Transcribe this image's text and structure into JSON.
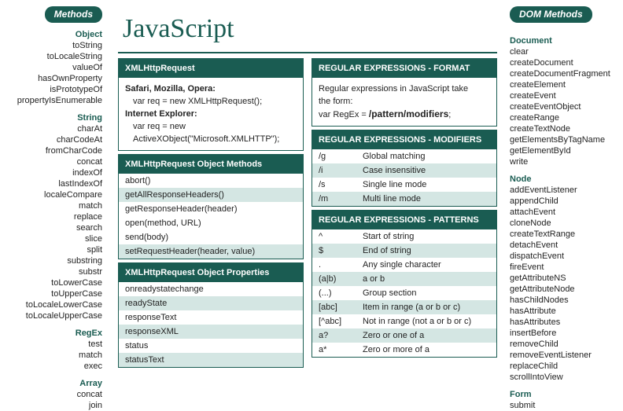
{
  "title": "JavaScript",
  "left_badge": "Methods",
  "right_badge": "DOM Methods",
  "left_groups": [
    {
      "title": "Object",
      "items": [
        "toString",
        "toLocaleString",
        "valueOf",
        "hasOwnProperty",
        "isPrototypeOf",
        "propertyIsEnumerable"
      ]
    },
    {
      "title": "String",
      "items": [
        "charAt",
        "charCodeAt",
        "fromCharCode",
        "concat",
        "indexOf",
        "lastIndexOf",
        "localeCompare",
        "match",
        "replace",
        "search",
        "slice",
        "split",
        "substring",
        "substr",
        "toLowerCase",
        "toUpperCase",
        "toLocaleLowerCase",
        "toLocaleUpperCase"
      ]
    },
    {
      "title": "RegEx",
      "items": [
        "test",
        "match",
        "exec"
      ]
    },
    {
      "title": "Array",
      "items": [
        "concat",
        "join"
      ]
    }
  ],
  "right_groups": [
    {
      "title": "Document",
      "items": [
        "clear",
        "createDocument",
        "createDocumentFragment",
        "createElement",
        "createEvent",
        "createEventObject",
        "createRange",
        "createTextNode",
        "getElementsByTagName",
        "getElementById",
        "write"
      ]
    },
    {
      "title": "Node",
      "items": [
        "addEventListener",
        "appendChild",
        "attachEvent",
        "cloneNode",
        "createTextRange",
        "detachEvent",
        "dispatchEvent",
        "fireEvent",
        "getAttributeNS",
        "getAttributeNode",
        "hasChildNodes",
        "hasAttribute",
        "hasAttributes",
        "insertBefore",
        "removeChild",
        "removeEventListener",
        "replaceChild",
        "scrollIntoView"
      ]
    },
    {
      "title": "Form",
      "items": [
        "submit"
      ]
    }
  ],
  "xhr": {
    "header": "XMLHttpRequest",
    "b1_label": "Safari, Mozilla, Opera:",
    "b1_code": "var req = new XMLHttpRequest();",
    "b2_label": "Internet Explorer:",
    "b2_code1": "var req = new",
    "b2_code2": "ActiveXObject(\"Microsoft.XMLHTTP\");"
  },
  "xhr_methods": {
    "header": "XMLHttpRequest Object Methods",
    "items": [
      "abort()",
      "getAllResponseHeaders()",
      "getResponseHeader(header)",
      "open(method, URL)",
      "send(body)",
      "setRequestHeader(header, value)"
    ]
  },
  "xhr_props": {
    "header": "XMLHttpRequest Object Properties",
    "items": [
      "onreadystatechange",
      "readyState",
      "responseText",
      "responseXML",
      "status",
      "statusText"
    ]
  },
  "regex_format": {
    "header": "REGULAR EXPRESSIONS - FORMAT",
    "line1": "Regular expressions in JavaScript take",
    "line2": "the form:",
    "line3_pre": "var RegEx = ",
    "line3_bold": "/pattern/modifiers",
    "line3_post": ";"
  },
  "regex_mod": {
    "header": "REGULAR EXPRESSIONS - MODIFIERS",
    "rows": [
      {
        "k": "/g",
        "v": "Global matching"
      },
      {
        "k": "/i",
        "v": "Case insensitive"
      },
      {
        "k": "/s",
        "v": "Single line mode"
      },
      {
        "k": "/m",
        "v": "Multi line mode"
      }
    ]
  },
  "regex_pat": {
    "header": "REGULAR EXPRESSIONS - PATTERNS",
    "rows": [
      {
        "k": "^",
        "v": "Start of string"
      },
      {
        "k": "$",
        "v": "End of string"
      },
      {
        "k": ".",
        "v": "Any single character"
      },
      {
        "k": "(a|b)",
        "v": "a or b"
      },
      {
        "k": "(...)",
        "v": "Group section"
      },
      {
        "k": "[abc]",
        "v": "Item in range (a or b or c)"
      },
      {
        "k": "[^abc]",
        "v": "Not in range (not a or b or c)"
      },
      {
        "k": "a?",
        "v": "Zero or one of a"
      },
      {
        "k": "a*",
        "v": "Zero or more of a"
      }
    ]
  }
}
